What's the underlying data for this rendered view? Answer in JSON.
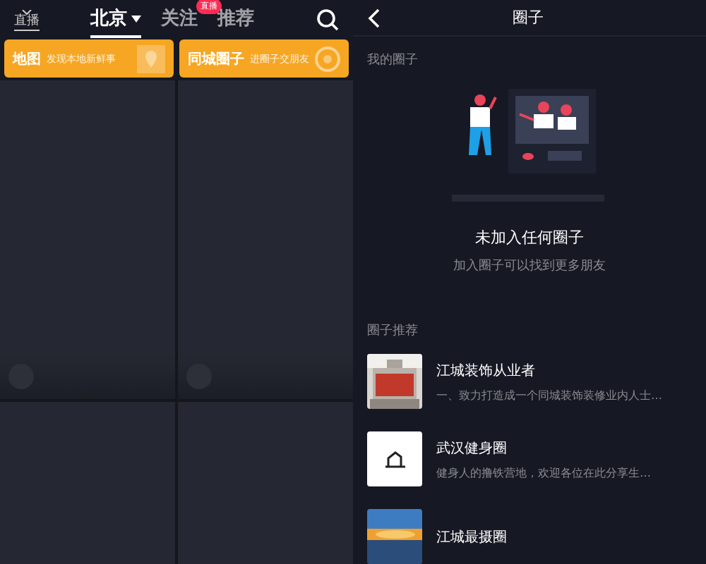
{
  "left_screen": {
    "live_icon_label": "直播",
    "tabs": [
      {
        "label": "北京",
        "selected": true,
        "dropdown": true
      },
      {
        "label": "关注",
        "selected": false,
        "dropdown": false,
        "badge": "直播"
      },
      {
        "label": "推荐",
        "selected": false,
        "dropdown": false
      }
    ],
    "banners": [
      {
        "title": "地图",
        "subtitle": "发现本地新鲜事",
        "kind": "map"
      },
      {
        "title": "同城圈子",
        "subtitle": "进圈子交朋友",
        "kind": "circle"
      }
    ],
    "tiles": [
      {
        "kind": "placeholder",
        "avatar": true
      },
      {
        "kind": "placeholder",
        "avatar": true
      },
      {
        "kind": "placeholder",
        "avatar": false
      },
      {
        "kind": "placeholder",
        "avatar": false
      }
    ]
  },
  "right_screen": {
    "title": "圈子",
    "my_circles_label": "我的圈子",
    "empty_state": {
      "title": "未加入任何圈子",
      "subtitle": "加入圈子可以找到更多朋友"
    },
    "recommend_label": "圈子推荐",
    "circles": [
      {
        "name": "江城装饰从业者",
        "description": "一、致力打造成一个同城装饰装修业内人士…",
        "kind": "picture"
      },
      {
        "name": "武汉健身圈",
        "description": "健身人的撸铁营地，欢迎各位在此分享生…",
        "kind": "logo"
      },
      {
        "name": "江城最摄圈",
        "kind": "picture"
      }
    ]
  }
}
